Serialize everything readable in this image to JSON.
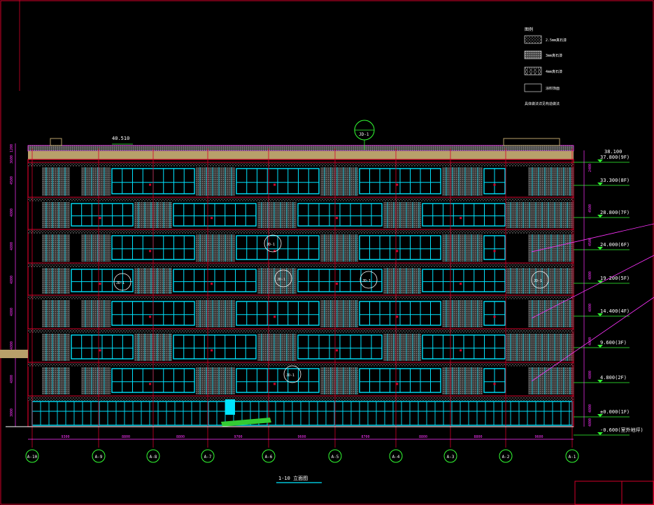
{
  "drawing": {
    "top_level_label": "40.510",
    "roof_level_label": "38.100",
    "title_block": "1-10 立面图",
    "detail_marks": [
      "JD-1",
      "JD-1",
      "JD-1",
      "JD-1",
      "JD-1",
      "JD-1",
      "JD-1"
    ]
  },
  "legend": {
    "title": "图例",
    "items": [
      {
        "label": "2.5mm真石漆",
        "pattern": "dots"
      },
      {
        "label": "3mm真石漆",
        "pattern": "dense"
      },
      {
        "label": "4mm真石漆",
        "pattern": "hex"
      },
      {
        "label": "涂料饰面",
        "pattern": "blank"
      }
    ],
    "note": "具体做法详见构造做法"
  },
  "levels": [
    {
      "label": "37.800(9F)"
    },
    {
      "label": "33.300(8F)"
    },
    {
      "label": "28.800(7F)"
    },
    {
      "label": "24.000(6F)"
    },
    {
      "label": "19.200(5F)"
    },
    {
      "label": "14.400(4F)"
    },
    {
      "label": "9.600(3F)"
    },
    {
      "label": "4.800(2F)"
    },
    {
      "label": "±0.000(1F)"
    },
    {
      "label": "-0.600(室外地坪)"
    }
  ],
  "axes": [
    "A-10",
    "A-9",
    "A-8",
    "A-7",
    "A-6",
    "A-5",
    "A-4",
    "A-3",
    "A-2",
    "A-1"
  ],
  "bay_widths": [
    "9300",
    "8800",
    "8800",
    "9700",
    "9600",
    "8700",
    "8800",
    "8800",
    "9600"
  ],
  "left_dims": [
    "1200",
    "3600",
    "4500",
    "4800",
    "4800",
    "4800",
    "4800",
    "4800",
    "4800",
    "3000"
  ],
  "right_dims": [
    "2400",
    "4500",
    "4500",
    "4800",
    "4800",
    "4800",
    "4800",
    "4800",
    "4800"
  ],
  "colors": {
    "background": "#000000",
    "frame": "#d4002a",
    "glass": "#00e5ff",
    "texture": "#8a8a8a",
    "axis_circle": "#33ff33",
    "dimension": "#ff33ff",
    "roof": "#b8a06a",
    "label": "#ffffff"
  }
}
